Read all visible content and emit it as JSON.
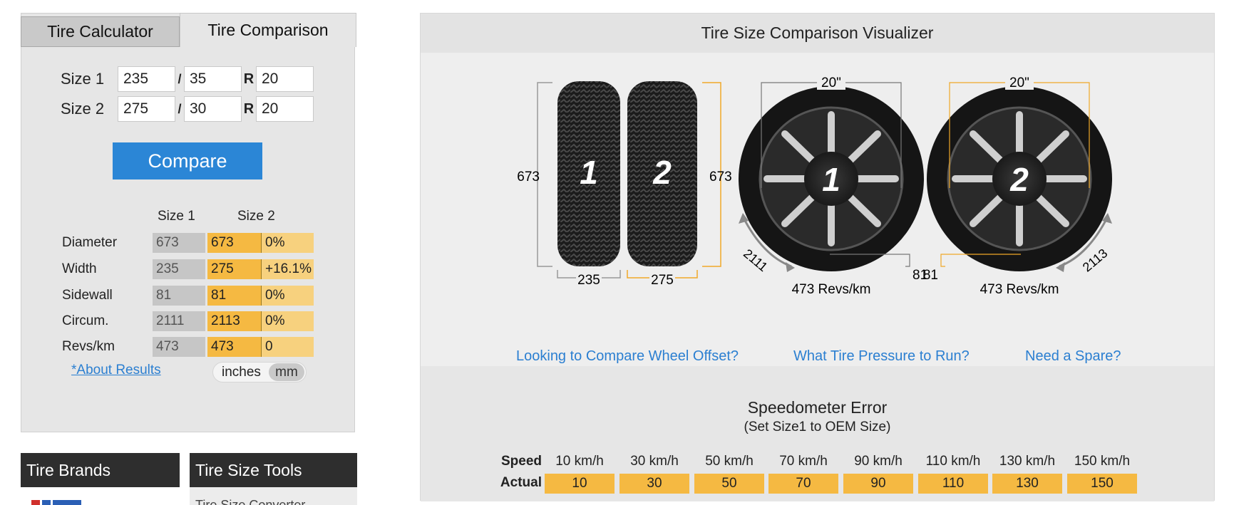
{
  "tabs": [
    "Tire Calculator",
    "Tire Comparison"
  ],
  "sizes": [
    {
      "label": "Size 1",
      "width": "235",
      "aspect": "35",
      "rim": "20"
    },
    {
      "label": "Size 2",
      "width": "275",
      "aspect": "30",
      "rim": "20"
    }
  ],
  "sep_slash": "/",
  "sep_r": "R",
  "compare_label": "Compare",
  "results": {
    "headers": [
      "Size 1",
      "Size 2"
    ],
    "rows": [
      {
        "label": "Diameter",
        "v1": "673",
        "v2": "673",
        "diff": "0%"
      },
      {
        "label": "Width",
        "v1": "235",
        "v2": "275",
        "diff": "+16.1%"
      },
      {
        "label": "Sidewall",
        "v1": "81",
        "v2": "81",
        "diff": "0%"
      },
      {
        "label": "Circum.",
        "v1": "2111",
        "v2": "2113",
        "diff": "0%"
      },
      {
        "label": "Revs/km",
        "v1": "473",
        "v2": "473",
        "diff": "0"
      }
    ]
  },
  "about_link": "*About Results",
  "units": {
    "inches": "inches",
    "mm": "mm"
  },
  "boxes": {
    "brands": "Tire Brands",
    "tools": "Tire Size Tools",
    "tools_sub": "Tire Size Converter"
  },
  "viz": {
    "title": "Tire Size Comparison Visualizer",
    "diam1": "673",
    "diam2": "673",
    "width1": "235",
    "width2": "275",
    "tire1_num": "1",
    "tire2_num": "2",
    "rim1": "20\"",
    "rim2": "20\"",
    "side1": "81",
    "side2": "81",
    "circ1": "2111",
    "circ2": "2113",
    "revs1": "473 Revs/km",
    "revs2": "473 Revs/km"
  },
  "links": [
    "Looking to Compare Wheel Offset?",
    "What Tire Pressure to Run?",
    "Need a Spare?"
  ],
  "speedo": {
    "title": "Speedometer Error",
    "subtitle": "(Set Size1 to OEM Size)",
    "speed_label": "Speed",
    "actual_label": "Actual",
    "speeds": [
      "10 km/h",
      "30 km/h",
      "50 km/h",
      "70 km/h",
      "90 km/h",
      "110 km/h",
      "130 km/h",
      "150 km/h"
    ],
    "actuals": [
      "10",
      "30",
      "50",
      "70",
      "90",
      "110",
      "130",
      "150"
    ]
  },
  "colors": {
    "accent": "#2b86d6",
    "highlight": "#f5b942",
    "light_highlight": "#f7d17e",
    "link": "#2b7fd1",
    "dark_header": "#2e2e2e"
  }
}
